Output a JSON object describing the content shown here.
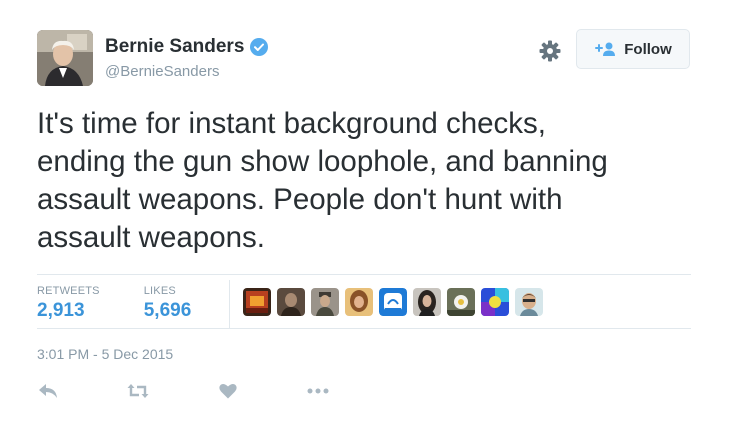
{
  "user": {
    "name": "Bernie Sanders",
    "handle": "@BernieSanders",
    "verified": true
  },
  "follow_label": "Follow",
  "tweet_text": "It's time for instant background checks,\nending the gun show loophole, and banning\nassault weapons. People don't hunt with\nassault weapons.",
  "stats": {
    "retweets_label": "RETWEETS",
    "retweets_value": "2,913",
    "likes_label": "LIKES",
    "likes_value": "5,696"
  },
  "timestamp": "3:01 PM - 5 Dec 2015",
  "colors": {
    "link_blue": "#3b94d9",
    "muted_gray": "#8899a6",
    "verified_blue": "#55acee"
  },
  "icons": [
    "verified-badge-icon",
    "gear-icon",
    "follow-person-icon",
    "reply-icon",
    "retweet-icon",
    "like-heart-icon",
    "more-dots-icon"
  ]
}
